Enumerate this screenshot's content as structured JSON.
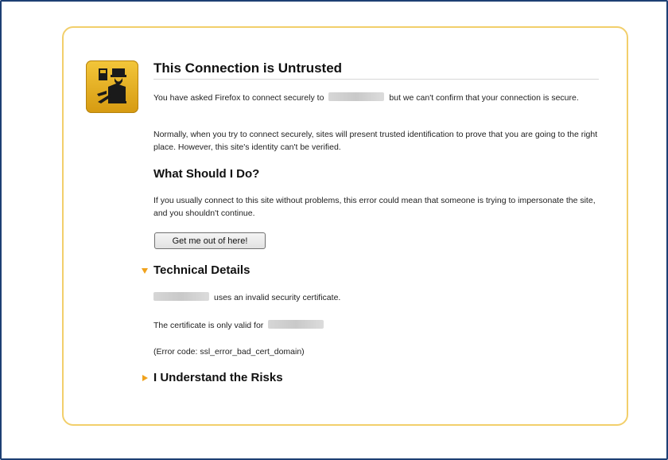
{
  "page": {
    "title": "This Connection is Untrusted",
    "intro_prefix": "You have asked Firefox to connect securely to",
    "intro_suffix": "but we can't confirm that your connection is secure.",
    "normal_text": "Normally, when you try to connect securely, sites will present trusted identification to prove that you are going to the right place. However, this site's identity can't be verified.",
    "what_heading": "What Should I Do?",
    "what_text": "If you usually connect to this site without problems, this error could mean that someone is trying to impersonate the site, and you shouldn't continue.",
    "button_label": "Get me out of here!",
    "technical_heading": "Technical Details",
    "tech_line1_suffix": "uses an invalid security certificate.",
    "tech_line2_prefix": "The certificate is only valid for",
    "tech_error": "(Error code: ssl_error_bad_cert_domain)",
    "risks_heading": "I Understand the Risks"
  },
  "colors": {
    "frame_border": "#1d3f73",
    "panel_border": "#f2cf6b",
    "icon_bg": "#e5b321",
    "triangle": "#f0a21c"
  },
  "icons": {
    "main": "security-guard-icon",
    "expanded": "triangle-down-icon",
    "collapsed": "triangle-right-icon"
  }
}
